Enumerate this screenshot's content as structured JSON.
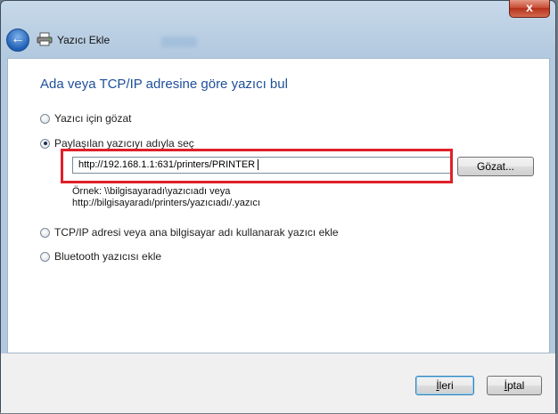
{
  "window": {
    "title": "Yazıcı Ekle",
    "close_symbol": "x"
  },
  "page": {
    "heading": "Ada veya TCP/IP adresine göre yazıcı bul"
  },
  "options": [
    {
      "label": "Yazıcı için gözat",
      "checked": false
    },
    {
      "label": "Paylaşılan yazıcıyı adıyla seç",
      "checked": true
    },
    {
      "label": "TCP/IP adresi veya ana bilgisayar adı kullanarak yazıcı ekle",
      "checked": false
    },
    {
      "label": "Bluetooth yazıcısı ekle",
      "checked": false
    }
  ],
  "printer_name": {
    "value": "http://192.168.1.1:631/printers/PRINTER",
    "browse_label": "Gözat...",
    "example_line1": "Örnek: \\\\bilgisayaradı\\yazıcıadı veya",
    "example_line2": "http://bilgisayaradı/printers/yazıcıadı/.yazıcı"
  },
  "footer": {
    "next_first": "İ",
    "next_rest": "leri",
    "cancel_first": "İ",
    "cancel_rest": "ptal"
  },
  "colors": {
    "heading": "#1e4f9a",
    "highlight": "#e02029"
  },
  "icons": {
    "back": "back-arrow-icon",
    "printer": "printer-icon"
  }
}
